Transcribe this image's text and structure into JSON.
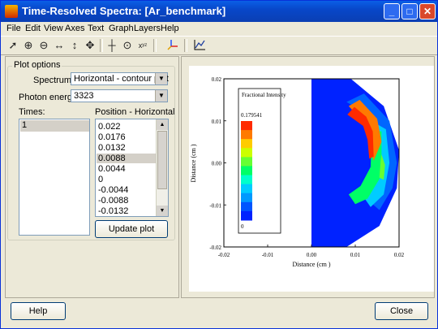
{
  "window": {
    "title": "Time-Resolved Spectra: [Ar_benchmark]",
    "controls": [
      "_",
      "□",
      "✕"
    ]
  },
  "menu": [
    "File",
    "Edit",
    "View",
    "Axes",
    "Text",
    "Graph",
    "Layers",
    "Help"
  ],
  "toolbar": {
    "icons": [
      "pointer-icon",
      "zoom-in-icon",
      "zoom-out-icon",
      "pan-horizontal-icon",
      "pan-vertical-icon",
      "pan-both-icon",
      "crosshair-icon",
      "target-icon",
      "xyz-icon",
      "axes-3d-icon",
      "line-plot-icon"
    ]
  },
  "plot_options": {
    "group_label": "Plot options",
    "spectrum_label": "Spectrum:",
    "spectrum_value": "Horizontal - contour plot",
    "photon_label": "Photon energy:",
    "photon_value": "3323",
    "times_label": "Times:",
    "times": [
      "1"
    ],
    "position_label": "Position - Horizontal",
    "positions": [
      "0.022",
      "0.0176",
      "0.0132",
      "0.0088",
      "0.0044",
      "0",
      "-0.0044",
      "-0.0088",
      "-0.0132"
    ],
    "selected_position": "0.0088",
    "update_button": "Update plot"
  },
  "chart_data": {
    "type": "heatmap",
    "xlabel": "Distance (cm )",
    "ylabel": "Distance (cm )",
    "xlim": [
      -0.02,
      0.02
    ],
    "ylim": [
      -0.02,
      0.02
    ],
    "x_ticks": [
      "-0.02",
      "-0.01",
      "0.00",
      "0.01",
      "0.02"
    ],
    "y_ticks": [
      "0.02",
      "0.01",
      "0.00",
      "-0.01",
      "-0.02"
    ],
    "legend_title": "Fractional Intensity",
    "legend_max": "0.179541",
    "legend_min": "0",
    "colorbar_colors": [
      "#ff2a00",
      "#ff7a00",
      "#ffcc00",
      "#ccff00",
      "#66ff33",
      "#00ff66",
      "#00ffcc",
      "#00ccff",
      "#0099ff",
      "#0055ff",
      "#0022ff"
    ]
  },
  "footer": {
    "help_button": "Help",
    "close_button": "Close"
  }
}
